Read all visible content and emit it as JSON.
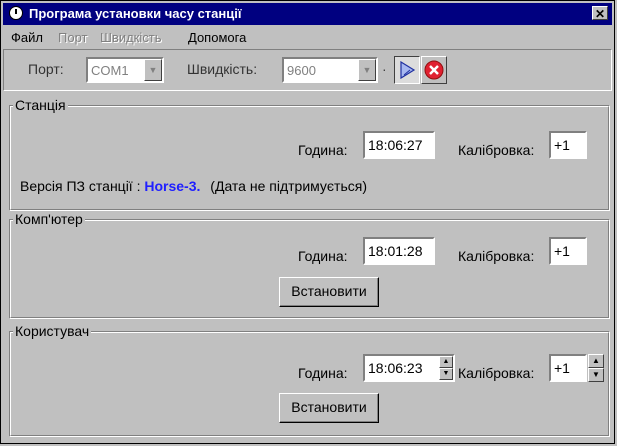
{
  "window": {
    "title": "Програма установки часу станції",
    "close_glyph": "✕"
  },
  "menu": [
    {
      "label": "Файл",
      "enabled": true
    },
    {
      "label": "Порт",
      "enabled": false
    },
    {
      "label": "Швидкість",
      "enabled": false
    },
    {
      "label": "Допомога",
      "enabled": true
    }
  ],
  "toolbar": {
    "port_label": "Порт:",
    "port_value": "COM1",
    "speed_label": "Швидкість:",
    "speed_value": "9600",
    "separator": "·",
    "connect_icon": "play-icon",
    "stop_icon": "close-circle-icon"
  },
  "station": {
    "legend": "Станція",
    "time_label": "Година:",
    "time_value": "18:06:27",
    "calib_label": "Калібровка:",
    "calib_value": "+1",
    "version_prefix": "Версія ПЗ станції :",
    "version_model": "Horse-3.",
    "version_note": "(Дата не підтримується)"
  },
  "computer": {
    "legend": "Комп'ютер",
    "time_label": "Година:",
    "time_value": "18:01:28",
    "calib_label": "Калібровка:",
    "calib_value": "+1",
    "set_button": "Встановити"
  },
  "user": {
    "legend": "Користувач",
    "time_label": "Година:",
    "time_value": "18:06:23",
    "calib_label": "Калібровка:",
    "calib_value": "+1",
    "set_button": "Встановити"
  },
  "colors": {
    "title_bar": "#000080",
    "face": "#c0c0c0",
    "model_text": "#2020ff",
    "stop_red": "#e02030"
  }
}
